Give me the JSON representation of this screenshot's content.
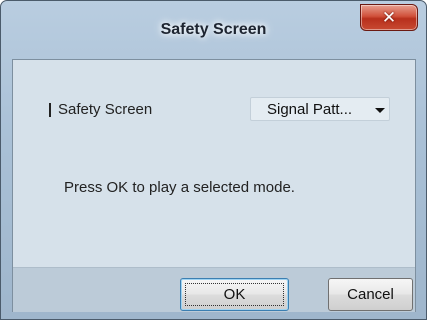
{
  "window": {
    "title": "Safety Screen",
    "close_icon": "close-icon",
    "close_glyph": "✕"
  },
  "form": {
    "field_label": "Safety Screen",
    "dropdown_selected": "Signal Patt...",
    "dropdown_icon": "chevron-down-icon"
  },
  "message": "Press OK to play a selected mode.",
  "buttons": {
    "ok_label": "OK",
    "cancel_label": "Cancel"
  },
  "colors": {
    "close_button": "#c84a32",
    "frame": "#a9c0d6",
    "content_bg": "#d6e1ea"
  }
}
